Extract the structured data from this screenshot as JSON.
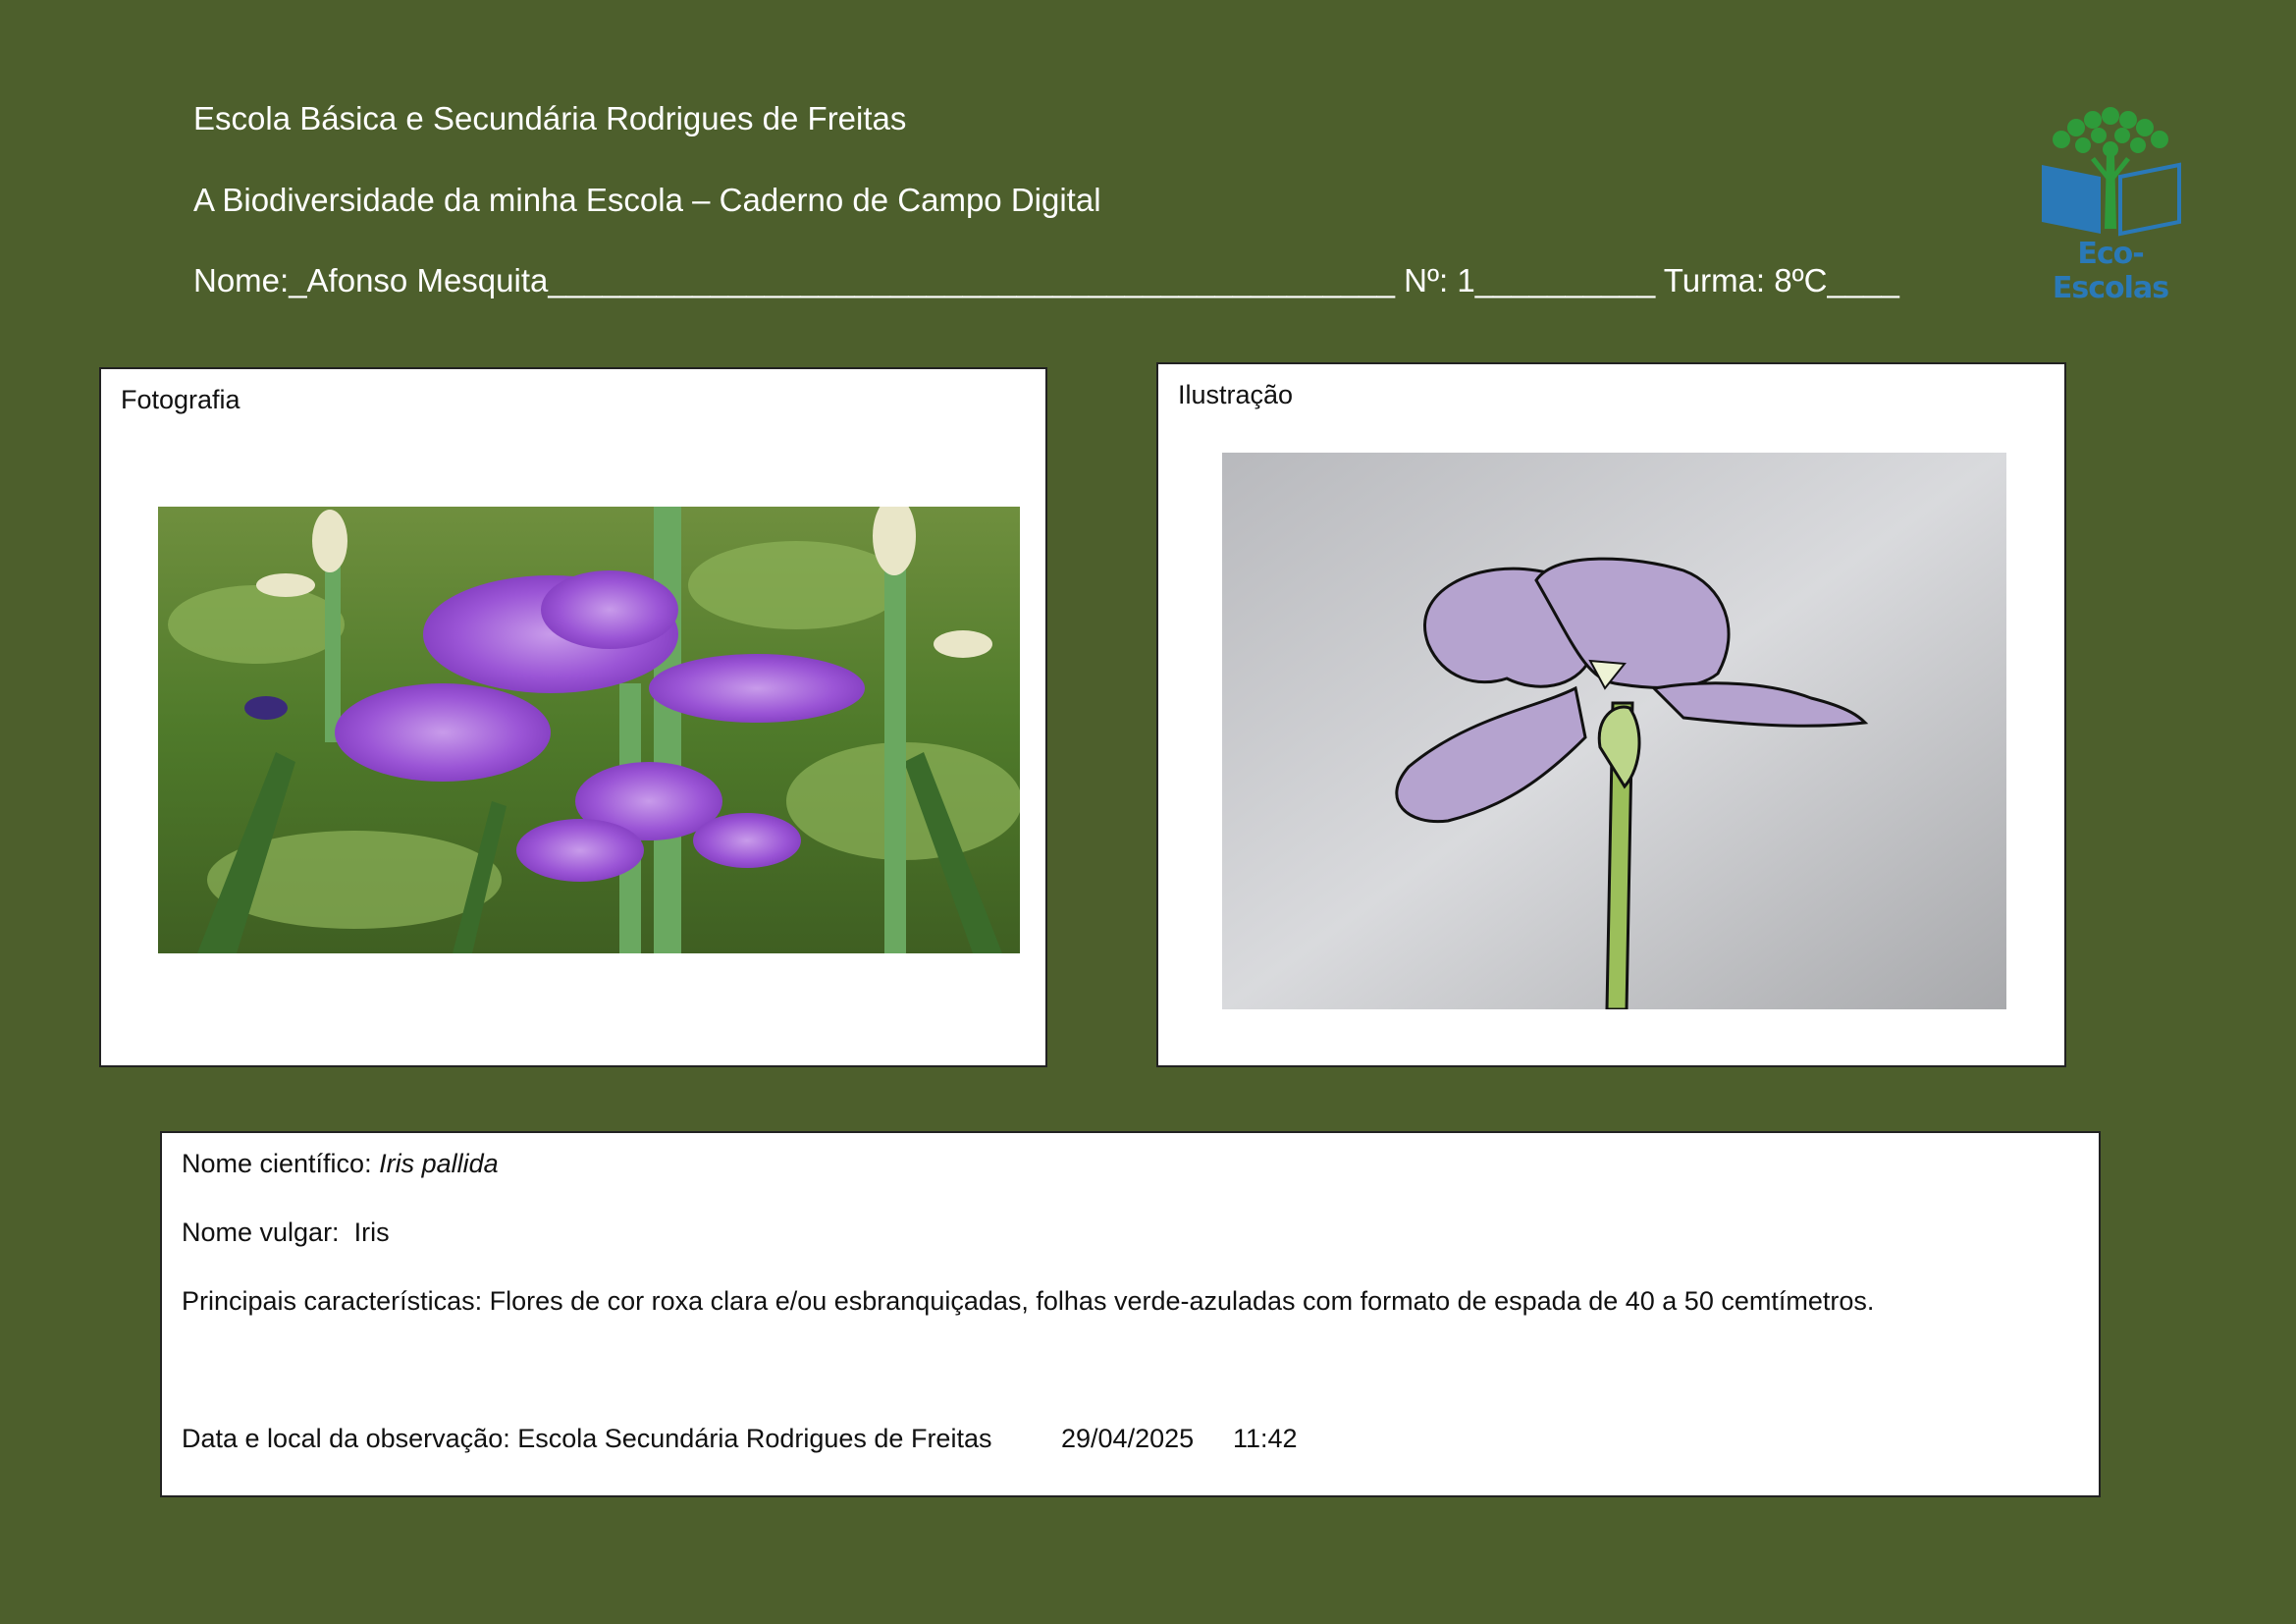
{
  "header": {
    "school": "Escola Básica e Secundária Rodrigues de Freitas",
    "project": "A Biodiversidade da minha Escola – Caderno de Campo Digital",
    "name_line": "Nome:_Afonso Mesquita_______________________________________________ Nº: 1__________ Turma: 8ºC____"
  },
  "logo": {
    "text": "Eco-Escolas"
  },
  "photo": {
    "label": "Fotografia"
  },
  "illustration": {
    "label": "Ilustração"
  },
  "info": {
    "scientific_label": "Nome científico: ",
    "scientific_value": "Iris pallida",
    "common_label": "Nome vulgar:  ",
    "common_value": "Iris",
    "features": "Principais características: Flores de cor roxa clara e/ou esbranquiçadas, folhas verde-azuladas com formato de espada de 40 a 50 cemtímetros.",
    "observation": "Data e local da observação: Escola Secundária Rodrigues de Freitas",
    "date": "29/04/2025",
    "time": "11:42"
  }
}
